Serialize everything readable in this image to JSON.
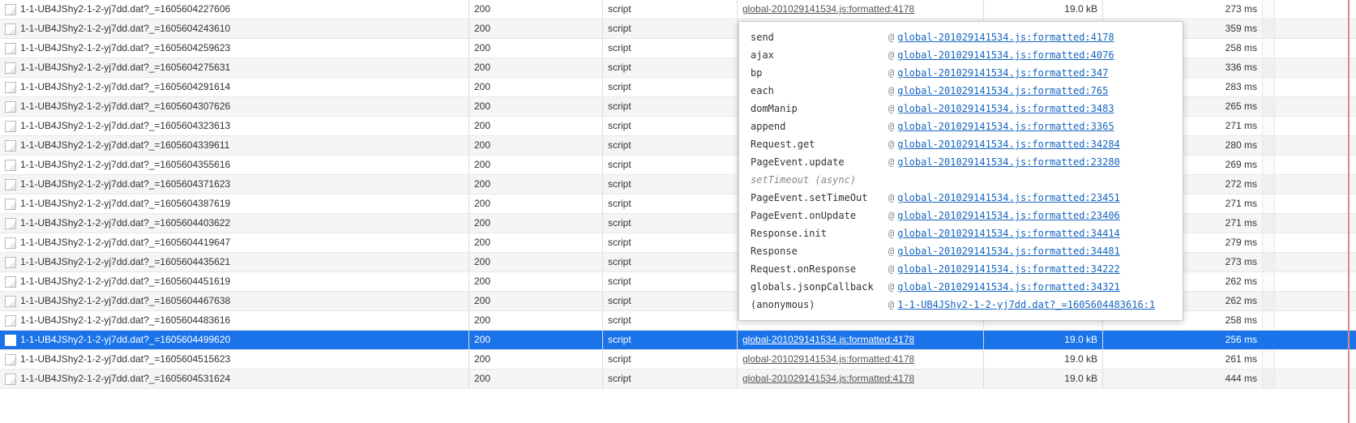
{
  "rows": [
    {
      "name": "1-1-UB4JShy2-1-2-yj7dd.dat?_=1605604227606",
      "status": "200",
      "type": "script",
      "initiator": "global-201029141534.js:formatted:4178",
      "size": "19.0 kB",
      "time": "273 ms",
      "even": false,
      "selected": false,
      "showInit": true
    },
    {
      "name": "1-1-UB4JShy2-1-2-yj7dd.dat?_=1605604243610",
      "status": "200",
      "type": "script",
      "initiator": "",
      "size": "",
      "time": "359 ms",
      "even": true,
      "selected": false,
      "showInit": false
    },
    {
      "name": "1-1-UB4JShy2-1-2-yj7dd.dat?_=1605604259623",
      "status": "200",
      "type": "script",
      "initiator": "",
      "size": "",
      "time": "258 ms",
      "even": false,
      "selected": false,
      "showInit": false
    },
    {
      "name": "1-1-UB4JShy2-1-2-yj7dd.dat?_=1605604275631",
      "status": "200",
      "type": "script",
      "initiator": "",
      "size": "",
      "time": "336 ms",
      "even": true,
      "selected": false,
      "showInit": false
    },
    {
      "name": "1-1-UB4JShy2-1-2-yj7dd.dat?_=1605604291614",
      "status": "200",
      "type": "script",
      "initiator": "",
      "size": "",
      "time": "283 ms",
      "even": false,
      "selected": false,
      "showInit": false
    },
    {
      "name": "1-1-UB4JShy2-1-2-yj7dd.dat?_=1605604307626",
      "status": "200",
      "type": "script",
      "initiator": "",
      "size": "",
      "time": "265 ms",
      "even": true,
      "selected": false,
      "showInit": false
    },
    {
      "name": "1-1-UB4JShy2-1-2-yj7dd.dat?_=1605604323613",
      "status": "200",
      "type": "script",
      "initiator": "",
      "size": "",
      "time": "271 ms",
      "even": false,
      "selected": false,
      "showInit": false
    },
    {
      "name": "1-1-UB4JShy2-1-2-yj7dd.dat?_=1605604339611",
      "status": "200",
      "type": "script",
      "initiator": "",
      "size": "",
      "time": "280 ms",
      "even": true,
      "selected": false,
      "showInit": false
    },
    {
      "name": "1-1-UB4JShy2-1-2-yj7dd.dat?_=1605604355616",
      "status": "200",
      "type": "script",
      "initiator": "",
      "size": "",
      "time": "269 ms",
      "even": false,
      "selected": false,
      "showInit": false
    },
    {
      "name": "1-1-UB4JShy2-1-2-yj7dd.dat?_=1605604371623",
      "status": "200",
      "type": "script",
      "initiator": "",
      "size": "",
      "time": "272 ms",
      "even": true,
      "selected": false,
      "showInit": false
    },
    {
      "name": "1-1-UB4JShy2-1-2-yj7dd.dat?_=1605604387619",
      "status": "200",
      "type": "script",
      "initiator": "",
      "size": "",
      "time": "271 ms",
      "even": false,
      "selected": false,
      "showInit": false
    },
    {
      "name": "1-1-UB4JShy2-1-2-yj7dd.dat?_=1605604403622",
      "status": "200",
      "type": "script",
      "initiator": "",
      "size": "",
      "time": "271 ms",
      "even": true,
      "selected": false,
      "showInit": false
    },
    {
      "name": "1-1-UB4JShy2-1-2-yj7dd.dat?_=1605604419647",
      "status": "200",
      "type": "script",
      "initiator": "",
      "size": "",
      "time": "279 ms",
      "even": false,
      "selected": false,
      "showInit": false
    },
    {
      "name": "1-1-UB4JShy2-1-2-yj7dd.dat?_=1605604435621",
      "status": "200",
      "type": "script",
      "initiator": "",
      "size": "",
      "time": "273 ms",
      "even": true,
      "selected": false,
      "showInit": false
    },
    {
      "name": "1-1-UB4JShy2-1-2-yj7dd.dat?_=1605604451619",
      "status": "200",
      "type": "script",
      "initiator": "",
      "size": "",
      "time": "262 ms",
      "even": false,
      "selected": false,
      "showInit": false
    },
    {
      "name": "1-1-UB4JShy2-1-2-yj7dd.dat?_=1605604467638",
      "status": "200",
      "type": "script",
      "initiator": "",
      "size": "",
      "time": "262 ms",
      "even": true,
      "selected": false,
      "showInit": false
    },
    {
      "name": "1-1-UB4JShy2-1-2-yj7dd.dat?_=1605604483616",
      "status": "200",
      "type": "script",
      "initiator": "",
      "size": "",
      "time": "258 ms",
      "even": false,
      "selected": false,
      "showInit": false
    },
    {
      "name": "1-1-UB4JShy2-1-2-yj7dd.dat?_=1605604499620",
      "status": "200",
      "type": "script",
      "initiator": "global-201029141534.js:formatted:4178",
      "size": "19.0 kB",
      "time": "256 ms",
      "even": true,
      "selected": true,
      "showInit": true
    },
    {
      "name": "1-1-UB4JShy2-1-2-yj7dd.dat?_=1605604515623",
      "status": "200",
      "type": "script",
      "initiator": "global-201029141534.js:formatted:4178",
      "size": "19.0 kB",
      "time": "261 ms",
      "even": false,
      "selected": false,
      "showInit": true
    },
    {
      "name": "1-1-UB4JShy2-1-2-yj7dd.dat?_=1605604531624",
      "status": "200",
      "type": "script",
      "initiator": "global-201029141534.js:formatted:4178",
      "size": "19.0 kB",
      "time": "444 ms",
      "even": true,
      "selected": false,
      "showInit": true
    }
  ],
  "popup_frames": [
    {
      "fn": "send",
      "loc": "global-201029141534.js:formatted:4178",
      "async": false
    },
    {
      "fn": "ajax",
      "loc": "global-201029141534.js:formatted:4076",
      "async": false
    },
    {
      "fn": "bp",
      "loc": "global-201029141534.js:formatted:347",
      "async": false
    },
    {
      "fn": "each",
      "loc": "global-201029141534.js:formatted:765",
      "async": false
    },
    {
      "fn": "domManip",
      "loc": "global-201029141534.js:formatted:3483",
      "async": false
    },
    {
      "fn": "append",
      "loc": "global-201029141534.js:formatted:3365",
      "async": false
    },
    {
      "fn": "Request.get",
      "loc": "global-201029141534.js:formatted:34284",
      "async": false
    },
    {
      "fn": "PageEvent.update",
      "loc": "global-201029141534.js:formatted:23280",
      "async": false
    },
    {
      "fn": "setTimeout (async)",
      "loc": "",
      "async": true
    },
    {
      "fn": "PageEvent.setTimeOut",
      "loc": "global-201029141534.js:formatted:23451",
      "async": false
    },
    {
      "fn": "PageEvent.onUpdate",
      "loc": "global-201029141534.js:formatted:23406",
      "async": false
    },
    {
      "fn": "Response.init",
      "loc": "global-201029141534.js:formatted:34414",
      "async": false
    },
    {
      "fn": "Response",
      "loc": "global-201029141534.js:formatted:34481",
      "async": false
    },
    {
      "fn": "Request.onResponse",
      "loc": "global-201029141534.js:formatted:34222",
      "async": false
    },
    {
      "fn": "globals.jsonpCallback",
      "loc": "global-201029141534.js:formatted:34321",
      "async": false
    },
    {
      "fn": "(anonymous)",
      "loc": "1-1-UB4JShy2-1-2-yj7dd.dat?_=1605604483616:1",
      "async": false
    }
  ],
  "at": "@"
}
